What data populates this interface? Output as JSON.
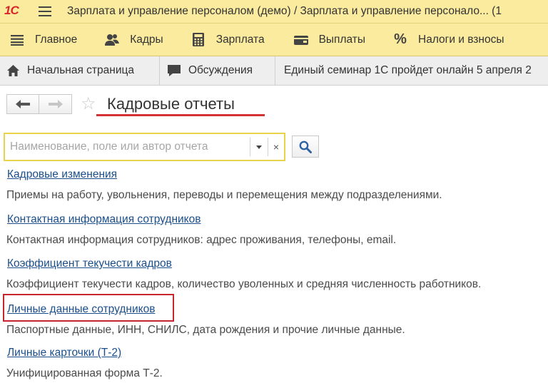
{
  "window": {
    "logo": "1С",
    "title": "Зарплата и управление персоналом (демо) / Зарплата и управление персонало...  (1"
  },
  "sections": [
    {
      "label": "Главное",
      "icon": "list-icon"
    },
    {
      "label": "Кадры",
      "icon": "people-icon"
    },
    {
      "label": "Зарплата",
      "icon": "calculator-icon"
    },
    {
      "label": "Выплаты",
      "icon": "wallet-icon"
    },
    {
      "label": "Налоги и взносы",
      "icon": "percent-icon"
    }
  ],
  "tabs": [
    {
      "label": "Начальная страница",
      "icon": "home-icon"
    },
    {
      "label": "Обсуждения",
      "icon": "chat-icon"
    },
    {
      "label": "Единый семинар 1С пройдет онлайн 5 апреля 2"
    }
  ],
  "form": {
    "title": "Кадровые отчеты"
  },
  "search": {
    "value": "",
    "placeholder": "Наименование, поле или автор отчета",
    "clear_label": "×"
  },
  "reports": [
    {
      "title": "Кадровые изменения",
      "description": "Приемы на работу, увольнения, переводы и перемещения между подразделениями."
    },
    {
      "title": "Контактная информация сотрудников",
      "description": "Контактная информация сотрудников: адрес проживания, телефоны, email."
    },
    {
      "title": "Коэффициент текучести кадров",
      "description": "Коэффициент текучести кадров, количество уволенных и средняя численность работников."
    },
    {
      "title": "Личные данные сотрудников",
      "description": "Паспортные данные, ИНН, СНИЛС, дата рождения и прочие личные данные."
    },
    {
      "title": "Личные карточки (Т-2)",
      "description": "Унифицированная форма Т-2."
    }
  ],
  "colors": {
    "panel_yellow": "#fbeb9e",
    "link_blue": "#1a4f8b",
    "highlight_red": "#c8262e",
    "search_border": "#e8d34a"
  }
}
